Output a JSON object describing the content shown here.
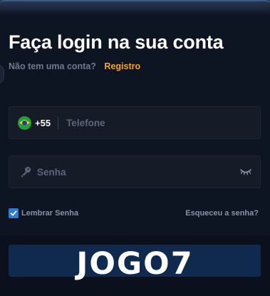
{
  "header": {
    "title": "Faça login na sua conta",
    "no_account_text": "Não tem uma conta?",
    "register_link": "Registro"
  },
  "phone_field": {
    "country_flag_icon": "brazil-flag-icon",
    "country_code": "+55",
    "placeholder": "Telefone",
    "value": ""
  },
  "password_field": {
    "icon": "key-icon",
    "placeholder": "Senha",
    "value": "",
    "toggle_icon": "eye-closed-icon"
  },
  "options": {
    "remember_label": "Lembrar Senha",
    "remember_checked": true,
    "forgot_link": "Esqueceu a senha?"
  },
  "login_button": {
    "label": ""
  },
  "watermark": {
    "text": "JOGO7"
  },
  "colors": {
    "background": "#0d1422",
    "field_background": "#151c28",
    "accent_orange": "#f5a623",
    "checkbox_blue": "#2d7bd6",
    "button_blue": "#0f2a4e"
  }
}
